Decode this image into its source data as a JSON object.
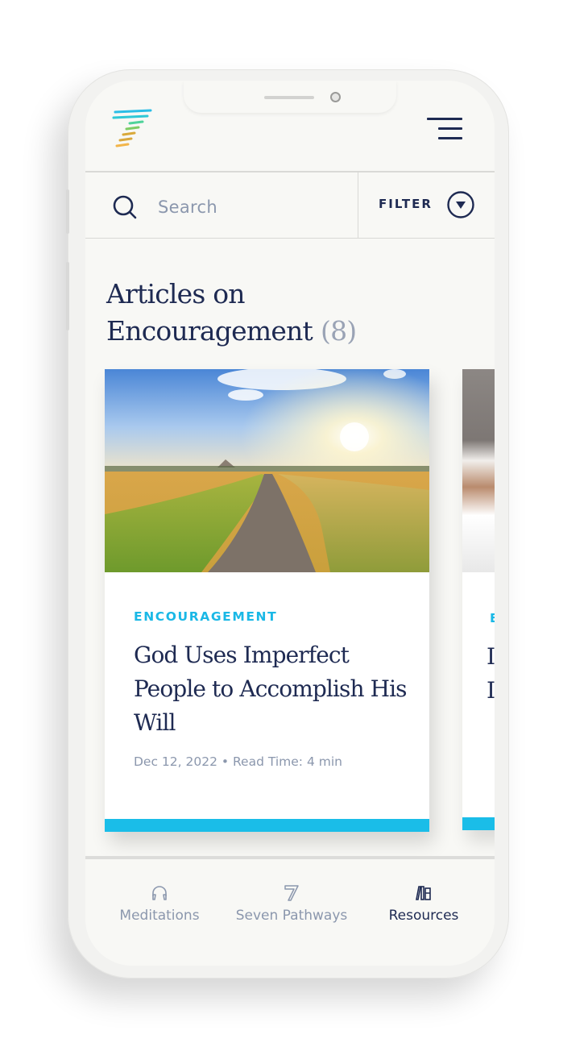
{
  "header": {
    "logo_icon": "seven-pathways-logo-icon",
    "menu_icon": "hamburger-menu-icon"
  },
  "search": {
    "placeholder": "Search",
    "value": "",
    "icon": "search-icon"
  },
  "filter": {
    "label": "FILTER",
    "icon": "circle-chevron-down-icon"
  },
  "page": {
    "title_line1": "Articles on",
    "title_line2": "Encouragement",
    "count": "(8)"
  },
  "cards": [
    {
      "image": "sunlit-field-path-photo",
      "tag": "ENCOURAGEMENT",
      "title": "God Uses Imperfect People to Accomplish His Will",
      "date": "Dec 12, 2022",
      "separator": "•",
      "read_time": "Read Time: 4 min"
    },
    {
      "image": "hands-with-book-photo",
      "tag": "E",
      "title_line1": "I",
      "title_line2": "I"
    }
  ],
  "colors": {
    "navy": "#1e2a52",
    "accent": "#1abde8",
    "muted": "#8b97ad",
    "background": "#f8f8f5"
  },
  "tabbar": {
    "items": [
      {
        "label": "Meditations",
        "icon": "headphones-icon",
        "active": false
      },
      {
        "label": "Seven Pathways",
        "icon": "seven-icon",
        "active": false
      },
      {
        "label": "Resources",
        "icon": "books-icon",
        "active": true
      }
    ]
  }
}
